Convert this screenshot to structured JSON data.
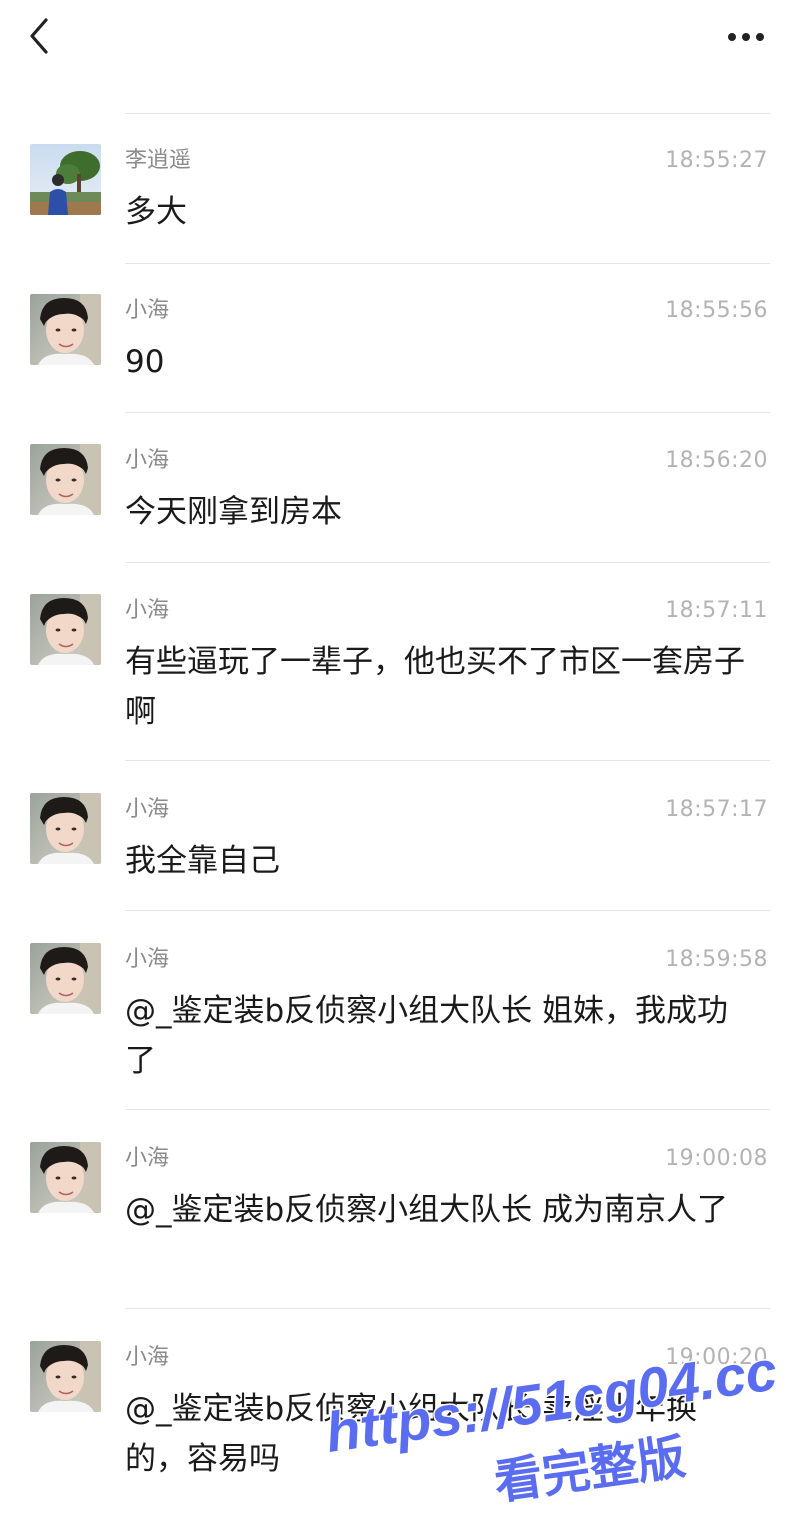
{
  "topbar": {
    "back_icon": "chevron-left-icon",
    "more_icon": "more-dots-icon"
  },
  "messages": [
    {
      "sender": "李逍遥",
      "time": "18:55:27",
      "text": "多大",
      "avatar": "landscape-avatar"
    },
    {
      "sender": "小海",
      "time": "18:55:56",
      "text": "90",
      "avatar": "portrait-avatar"
    },
    {
      "sender": "小海",
      "time": "18:56:20",
      "text": "今天刚拿到房本",
      "avatar": "portrait-avatar"
    },
    {
      "sender": "小海",
      "time": "18:57:11",
      "text": "有些逼玩了一辈子，他也买不了市区一套房子啊",
      "avatar": "portrait-avatar"
    },
    {
      "sender": "小海",
      "time": "18:57:17",
      "text": "我全靠自己",
      "avatar": "portrait-avatar"
    },
    {
      "sender": "小海",
      "time": "18:59:58",
      "text": "@_鉴定装b反侦察小组大队长 姐妹，我成功了",
      "avatar": "portrait-avatar"
    },
    {
      "sender": "小海",
      "time": "19:00:08",
      "text": "@_鉴定装b反侦察小组大队长 成为南京人了",
      "avatar": "portrait-avatar"
    },
    {
      "sender": "小海",
      "time": "19:00:20",
      "text": "@_鉴定装b反侦察小组大队长 卖淫十年换的，容易吗",
      "avatar": "portrait-avatar"
    }
  ],
  "watermark": {
    "line1": "https://51cg04.cc",
    "line2": "看完整版"
  },
  "colors": {
    "text": "#1a1a1a",
    "sender": "#8a8a8a",
    "time": "#b3b3b3",
    "divider": "#e6e6e6",
    "watermark": "#5a6df0"
  }
}
